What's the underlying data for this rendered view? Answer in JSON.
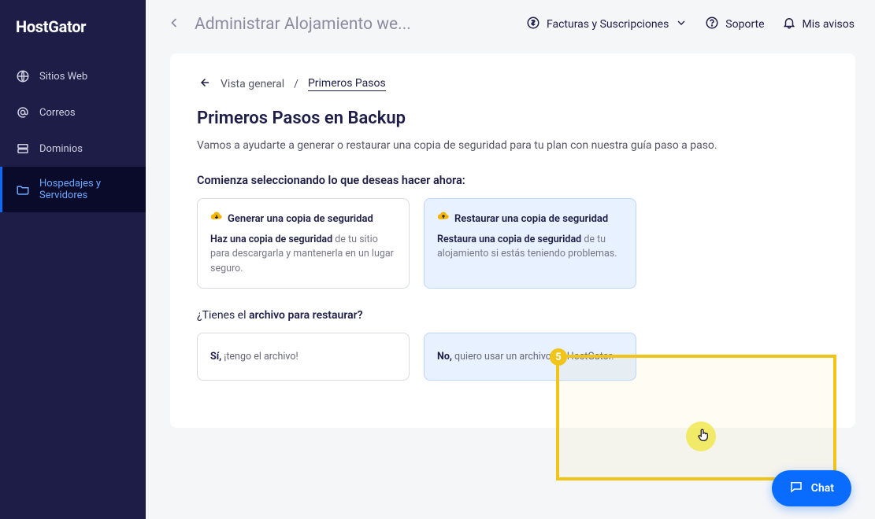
{
  "brand": "HostGator",
  "sidebar": {
    "items": [
      {
        "label": "Sitios Web"
      },
      {
        "label": "Correos"
      },
      {
        "label": "Dominios"
      },
      {
        "label": "Hospedajes y Servidores"
      }
    ]
  },
  "topbar": {
    "title": "Administrar Alojamiento we...",
    "billing": "Facturas y Suscripciones",
    "support": "Soporte",
    "notices": "Mis avisos"
  },
  "breadcrumb": {
    "prev": "Vista general",
    "sep": "/",
    "current": "Primeros Pasos"
  },
  "page": {
    "title": "Primeros Pasos en Backup",
    "subtitle": "Vamos a ayudarte a generar o restaurar una copia de seguridad para tu plan con nuestra guía paso a paso.",
    "section1": "Comienza seleccionando lo que deseas hacer ahora:"
  },
  "options": {
    "gen": {
      "title": "Generar una copia de seguridad",
      "desc_strong": "Haz una copia de seguridad",
      "desc_light": " de tu sitio para descargarla y mantenerla en un lugar seguro."
    },
    "rest": {
      "title": "Restaurar una copia de seguridad",
      "desc_strong": "Restaura una copia de seguridad",
      "desc_light": " de tu alojamiento si estás teniendo problemas."
    }
  },
  "question2": {
    "prefix": "¿Tienes el ",
    "strong": "archivo para restaurar?"
  },
  "answers": {
    "yes": {
      "strong": "Sí,",
      "light": " ¡tengo el archivo!"
    },
    "no": {
      "strong": "No,",
      "light": " quiero usar un archivo de HostGator."
    }
  },
  "highlight": {
    "step": "5"
  },
  "chat": {
    "label": "Chat"
  }
}
